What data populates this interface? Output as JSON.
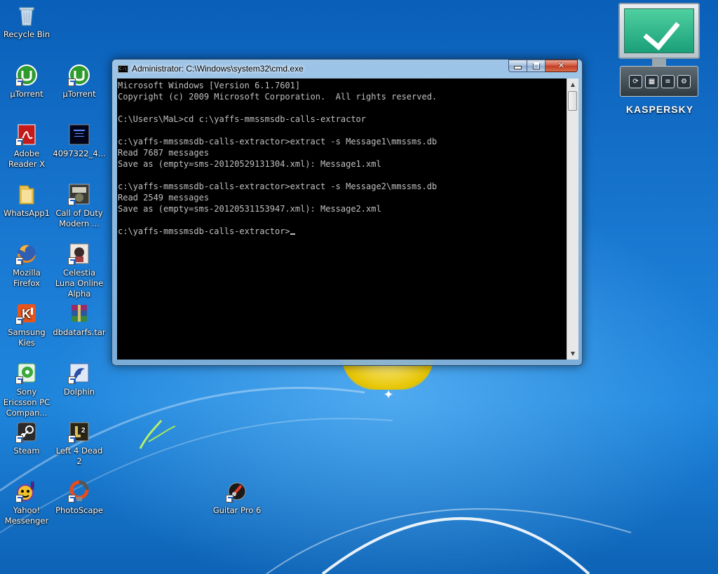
{
  "desktop": {
    "icons": [
      {
        "label": "Recycle Bin",
        "icon": "recycle-bin-icon"
      },
      {
        "label": "µTorrent",
        "icon": "utorrent-icon"
      },
      {
        "label": "µTorrent",
        "icon": "utorrent-icon"
      },
      {
        "label": "Adobe Reader X",
        "icon": "adobe-reader-icon"
      },
      {
        "label": "4097322_4...",
        "icon": "image-file-icon"
      },
      {
        "label": "WhatsApp1",
        "icon": "folder-icon"
      },
      {
        "label": "Call of Duty Modern ...",
        "icon": "call-of-duty-icon"
      },
      {
        "label": "Mozilla Firefox",
        "icon": "firefox-icon"
      },
      {
        "label": "Celestia Luna Online Alpha",
        "icon": "celestia-luna-icon"
      },
      {
        "label": "Samsung Kies",
        "icon": "samsung-kies-icon"
      },
      {
        "label": "dbdatarfs.tar",
        "icon": "winrar-archive-icon"
      },
      {
        "label": "Sony Ericsson PC Compan...",
        "icon": "sony-ericsson-icon"
      },
      {
        "label": "Dolphin",
        "icon": "dolphin-icon"
      },
      {
        "label": "Steam",
        "icon": "steam-icon"
      },
      {
        "label": "Left 4 Dead 2",
        "icon": "left4dead2-icon"
      },
      {
        "label": "Yahoo! Messenger",
        "icon": "yahoo-messenger-icon"
      },
      {
        "label": "PhotoScape",
        "icon": "photoscape-icon"
      },
      {
        "label": "Guitar Pro 6",
        "icon": "guitar-pro-icon"
      }
    ]
  },
  "cmd": {
    "title": "Administrator: C:\\Windows\\system32\\cmd.exe",
    "lines": [
      "Microsoft Windows [Version 6.1.7601]",
      "Copyright (c) 2009 Microsoft Corporation.  All rights reserved.",
      "",
      "C:\\Users\\MaL>cd c:\\yaffs-mmssmsdb-calls-extractor",
      "",
      "c:\\yaffs-mmssmsdb-calls-extractor>extract -s Message1\\mmssms.db",
      "Read 7687 messages",
      "Save as (empty=sms-20120529131304.xml): Message1.xml",
      "",
      "c:\\yaffs-mmssmsdb-calls-extractor>extract -s Message2\\mmssms.db",
      "Read 2549 messages",
      "Save as (empty=sms-20120531153947.xml): Message2.xml",
      "",
      "c:\\yaffs-mmssmsdb-calls-extractor>"
    ],
    "icon_text": "C:\\",
    "text_color": "#c0c0c0",
    "background_color": "#000000"
  },
  "kaspersky": {
    "name": "KASPERSKY",
    "status_color": "#2fbf8c",
    "buttons": [
      "update-icon",
      "calendar-icon",
      "report-icon",
      "settings-icon"
    ]
  }
}
